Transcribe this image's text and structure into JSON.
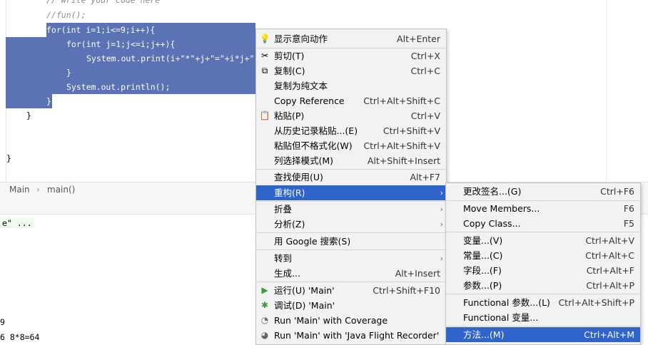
{
  "editor": {
    "lines": [
      "// Write your code here",
      "//fun();",
      "for(int i=1;i<=9;i++){",
      "for(int j=1;j<=i;j++){",
      "System.out.print(i+\"*\"+j+\"=\"+i*j+\"",
      "}",
      "System.out.println();",
      "}",
      "}",
      "}"
    ]
  },
  "breadcrumbs": {
    "first": "Main",
    "sep": "›",
    "second": "main()"
  },
  "run": {
    "hint": "e\" ...",
    "out1": "9",
    "out2": "6  8*8=64"
  },
  "context_menu": {
    "items": [
      {
        "icon": "💡",
        "label": "显示意向动作",
        "shortcut": "Alt+Enter"
      },
      {
        "icon": "✂",
        "label": "剪切(T)",
        "shortcut": "Ctrl+X"
      },
      {
        "icon": "⧉",
        "label": "复制(C)",
        "shortcut": "Ctrl+C"
      },
      {
        "icon": "",
        "label": "复制为纯文本",
        "shortcut": ""
      },
      {
        "icon": "",
        "label": "Copy Reference",
        "shortcut": "Ctrl+Alt+Shift+C"
      },
      {
        "icon": "📋",
        "label": "粘贴(P)",
        "shortcut": "Ctrl+V"
      },
      {
        "icon": "",
        "label": "从历史记录粘贴...(E)",
        "shortcut": "Ctrl+Shift+V"
      },
      {
        "icon": "",
        "label": "粘贴但不格式化(W)",
        "shortcut": "Ctrl+Alt+Shift+V"
      },
      {
        "icon": "",
        "label": "列选择模式(M)",
        "shortcut": "Alt+Shift+Insert"
      },
      {
        "icon": "",
        "label": "查找使用(U)",
        "shortcut": "Alt+F7"
      },
      {
        "icon": "",
        "label": "重构(R)",
        "shortcut": ""
      },
      {
        "icon": "",
        "label": "折叠",
        "shortcut": ""
      },
      {
        "icon": "",
        "label": "分析(Z)",
        "shortcut": ""
      },
      {
        "icon": "",
        "label": "用 Google 搜索(S)",
        "shortcut": ""
      },
      {
        "icon": "",
        "label": "转到",
        "shortcut": ""
      },
      {
        "icon": "",
        "label": "生成...",
        "shortcut": "Alt+Insert"
      },
      {
        "icon": "▶",
        "label": "运行(U) 'Main'",
        "shortcut": "Ctrl+Shift+F10"
      },
      {
        "icon": "✱",
        "label": "调试(D) 'Main'",
        "shortcut": ""
      },
      {
        "icon": "◔",
        "label": "Run 'Main' with Coverage",
        "shortcut": ""
      },
      {
        "icon": "◕",
        "label": "Run 'Main' with 'Java Flight Recorder'",
        "shortcut": ""
      }
    ]
  },
  "refactor_submenu": {
    "items": [
      {
        "label": "更改签名...(G)",
        "shortcut": "Ctrl+F6"
      },
      {
        "label": "Move Members...",
        "shortcut": "F6"
      },
      {
        "label": "Copy Class...",
        "shortcut": "F5"
      },
      {
        "label": "变量...(V)",
        "shortcut": "Ctrl+Alt+V"
      },
      {
        "label": "常量...(C)",
        "shortcut": "Ctrl+Alt+C"
      },
      {
        "label": "字段...(F)",
        "shortcut": "Ctrl+Alt+F"
      },
      {
        "label": "参数...(P)",
        "shortcut": "Ctrl+Alt+P"
      },
      {
        "label": "Functional 参数...(L)",
        "shortcut": "Ctrl+Alt+Shift+P"
      },
      {
        "label": "Functional 变量...",
        "shortcut": ""
      },
      {
        "label": "方法...(M)",
        "shortcut": "Ctrl+Alt+M"
      }
    ]
  },
  "colors": {
    "selection": "#5b72b5",
    "menu_highlight": "#2f65ca",
    "menu_bg": "#f2f2f2"
  }
}
